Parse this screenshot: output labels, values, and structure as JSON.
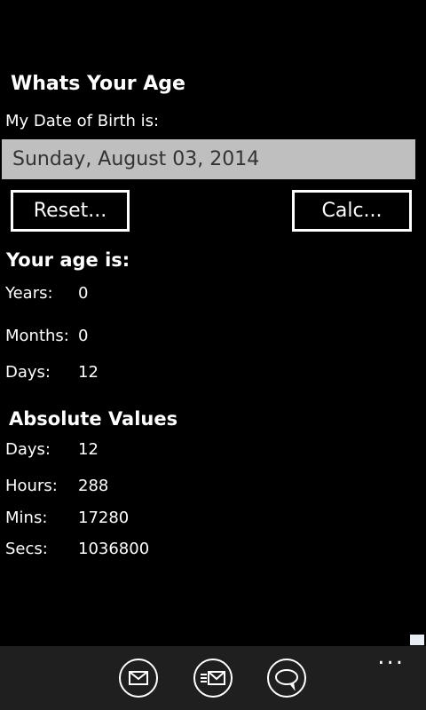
{
  "app": {
    "title": "Whats Your Age",
    "dob_label": "My Date of Birth is:",
    "dob_value": "Sunday, August 03, 2014"
  },
  "buttons": {
    "reset": "Reset...",
    "calc": "Calc..."
  },
  "age": {
    "heading": "Your age is:",
    "rows": [
      {
        "label": "Years:",
        "value": "0"
      },
      {
        "label": "Months:",
        "value": "0"
      },
      {
        "label": "Days:",
        "value": "12"
      }
    ]
  },
  "absolute": {
    "heading": "Absolute Values",
    "rows": [
      {
        "label": "Days:",
        "value": "12"
      },
      {
        "label": "Hours:",
        "value": "288"
      },
      {
        "label": "Mins:",
        "value": "17280"
      },
      {
        "label": "Secs:",
        "value": "1036800"
      }
    ]
  },
  "appbar": {
    "icons": [
      "mail-icon",
      "mail-list-icon",
      "chat-bubble-icon"
    ],
    "more": "..."
  },
  "colors": {
    "background": "#000000",
    "date_box": "#bfbfbf",
    "appbar": "#1f1f1f"
  }
}
